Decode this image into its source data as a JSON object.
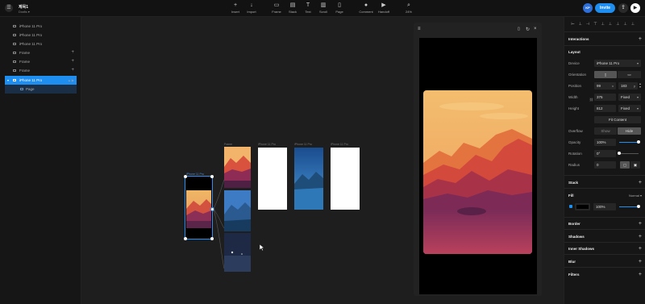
{
  "app": {
    "title": "제목1",
    "subtitle": "Drafts ▾"
  },
  "toolbar": {
    "tools": [
      {
        "icon": "plus-icon",
        "glyph": "+",
        "label": "Insert"
      },
      {
        "icon": "import-icon",
        "glyph": "↓",
        "label": "Import"
      },
      {
        "icon": "frame-icon",
        "glyph": "▭",
        "label": "Frame"
      },
      {
        "icon": "stack-icon",
        "glyph": "▤",
        "label": "Stack"
      },
      {
        "icon": "text-icon",
        "glyph": "T",
        "label": "Text"
      },
      {
        "icon": "scroll-icon",
        "glyph": "▥",
        "label": "Scroll"
      },
      {
        "icon": "page-icon",
        "glyph": "▯",
        "label": "Page"
      },
      {
        "icon": "comment-icon",
        "glyph": "●",
        "label": "Comment"
      },
      {
        "icon": "handoff-icon",
        "glyph": "▶",
        "label": "Handoff"
      },
      {
        "icon": "zoom-icon",
        "glyph": "⌕",
        "label": "24%"
      }
    ],
    "avatar": "KP",
    "invite_label": "Invite"
  },
  "layers": [
    {
      "label": "iPhone 11 Pro",
      "plus": ""
    },
    {
      "label": "iPhone 11 Pro",
      "plus": ""
    },
    {
      "label": "iPhone 11 Pro",
      "plus": ""
    },
    {
      "label": "Frame",
      "plus": "+"
    },
    {
      "label": "Frame",
      "plus": "+"
    },
    {
      "label": "Frame",
      "plus": "+"
    },
    {
      "label": "iPhone 11 Pro",
      "plus": "▲ ▶"
    },
    {
      "label": "Page",
      "plus": ""
    }
  ],
  "canvas": {
    "labels": [
      "iPhone 11 Pro",
      "Frame",
      "iPhone 11 Pro",
      "iPhone 11 Pro",
      "iPhone 11 Pro"
    ]
  },
  "props": {
    "sections": {
      "interactions": "Interactions",
      "layout": "Layout",
      "stack": "Stack",
      "fill": "Fill",
      "fill_mode": "Normal ▾",
      "border": "Border",
      "shadows": "Shadows",
      "inner_shadows": "Inner Shadows",
      "blur": "Blur",
      "filters": "Filters"
    },
    "device_label": "Device",
    "device_value": "iPhone 11 Pro",
    "orientation_label": "Orientation",
    "position_label": "Position",
    "position_x": "99",
    "position_x_unit": "x",
    "position_y": "183",
    "position_y_unit": "y",
    "width_label": "Width",
    "width_value": "375",
    "width_mode": "Fixed",
    "height_label": "Height",
    "height_value": "812",
    "height_mode": "Fixed",
    "fit_content": "Fit Content",
    "overflow_label": "Overflow",
    "overflow_show": "Show",
    "overflow_hide": "Hide",
    "opacity_label": "Opacity",
    "opacity_value": "100%",
    "opacity_level": 1.0,
    "rotation_label": "Rotation",
    "rotation_value": "0°",
    "rotation_level": 0.0,
    "radius_label": "Radius",
    "radius_value": "0",
    "fill_value": "100%",
    "fill_level": 1.0,
    "accent": "#1f8ef1"
  }
}
